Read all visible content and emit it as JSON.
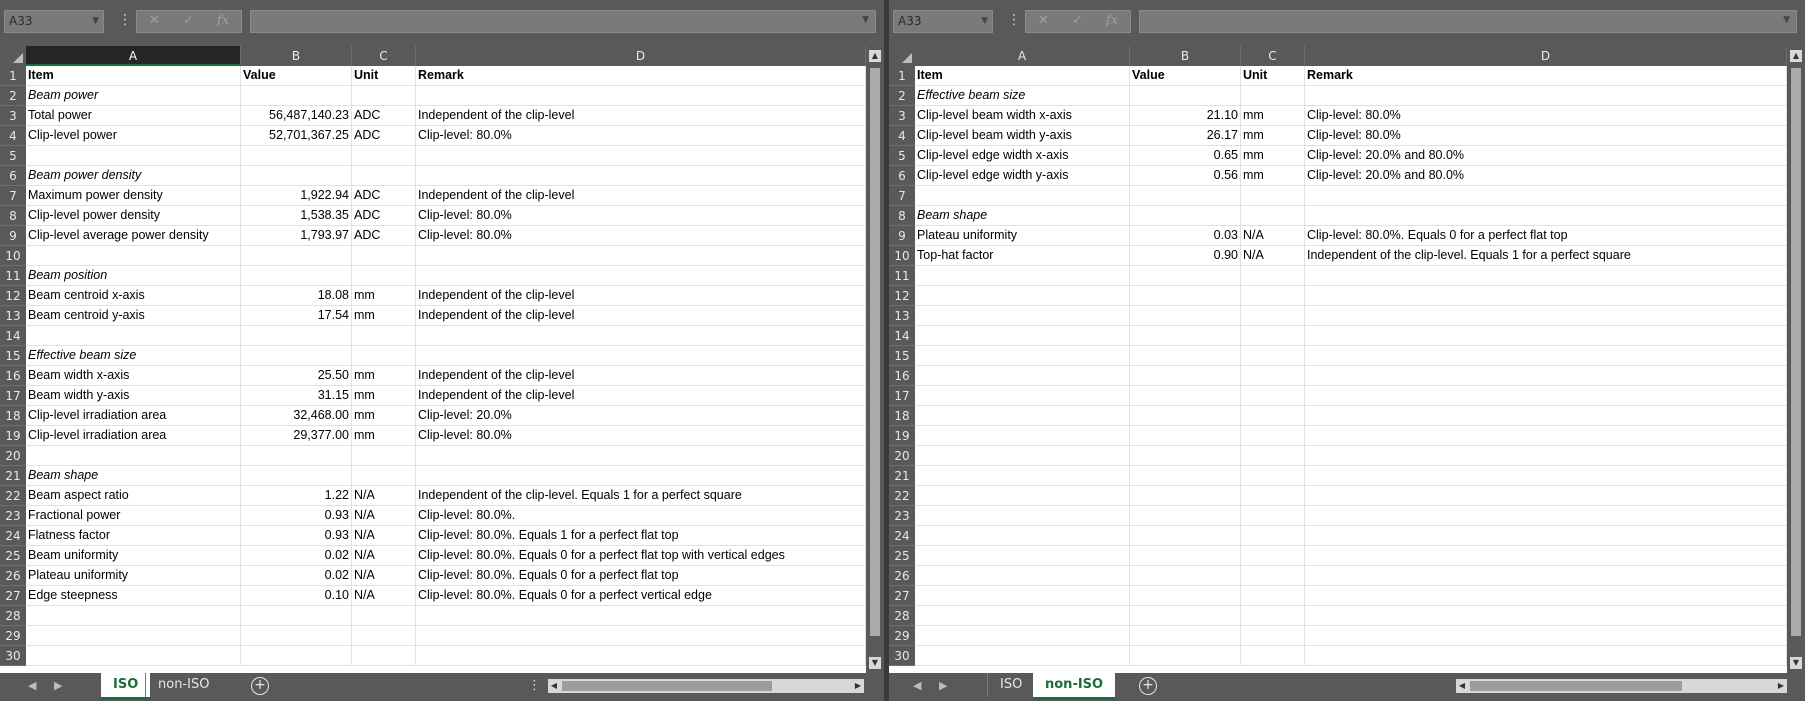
{
  "left": {
    "namebox": "A33",
    "columns": [
      "A",
      "B",
      "C",
      "D"
    ],
    "rows": [
      {
        "n": "1",
        "a": "Item",
        "b": "Value",
        "c": "Unit",
        "d": "Remark",
        "style": "bold"
      },
      {
        "n": "2",
        "a": "Beam power",
        "b": "",
        "c": "",
        "d": "",
        "style": "ital"
      },
      {
        "n": "3",
        "a": "Total power",
        "b": "56,487,140.23",
        "c": "ADC",
        "d": "Independent of the clip-level"
      },
      {
        "n": "4",
        "a": "Clip-level power",
        "b": "52,701,367.25",
        "c": "ADC",
        "d": "Clip-level: 80.0%"
      },
      {
        "n": "5",
        "a": "",
        "b": "",
        "c": "",
        "d": ""
      },
      {
        "n": "6",
        "a": "Beam power density",
        "b": "",
        "c": "",
        "d": "",
        "style": "ital"
      },
      {
        "n": "7",
        "a": "Maximum power density",
        "b": "1,922.94",
        "c": "ADC",
        "d": "Independent of the clip-level"
      },
      {
        "n": "8",
        "a": "Clip-level power density",
        "b": "1,538.35",
        "c": "ADC",
        "d": "Clip-level: 80.0%"
      },
      {
        "n": "9",
        "a": "Clip-level average power density",
        "b": "1,793.97",
        "c": "ADC",
        "d": "Clip-level: 80.0%"
      },
      {
        "n": "10",
        "a": "",
        "b": "",
        "c": "",
        "d": ""
      },
      {
        "n": "11",
        "a": "Beam position",
        "b": "",
        "c": "",
        "d": "",
        "style": "ital"
      },
      {
        "n": "12",
        "a": "Beam centroid x-axis",
        "b": "18.08",
        "c": "mm",
        "d": "Independent of the clip-level"
      },
      {
        "n": "13",
        "a": "Beam centroid y-axis",
        "b": "17.54",
        "c": "mm",
        "d": "Independent of the clip-level"
      },
      {
        "n": "14",
        "a": "",
        "b": "",
        "c": "",
        "d": ""
      },
      {
        "n": "15",
        "a": "Effective beam size",
        "b": "",
        "c": "",
        "d": "",
        "style": "ital"
      },
      {
        "n": "16",
        "a": "Beam width x-axis",
        "b": "25.50",
        "c": "mm",
        "d": "Independent of the clip-level"
      },
      {
        "n": "17",
        "a": "Beam width y-axis",
        "b": "31.15",
        "c": "mm",
        "d": "Independent of the clip-level"
      },
      {
        "n": "18",
        "a": "Clip-level irradiation area",
        "b": "32,468.00",
        "c": "mm",
        "d": "Clip-level: 20.0%"
      },
      {
        "n": "19",
        "a": "Clip-level irradiation area",
        "b": "29,377.00",
        "c": "mm",
        "d": "Clip-level: 80.0%"
      },
      {
        "n": "20",
        "a": "",
        "b": "",
        "c": "",
        "d": ""
      },
      {
        "n": "21",
        "a": "Beam shape",
        "b": "",
        "c": "",
        "d": "",
        "style": "ital"
      },
      {
        "n": "22",
        "a": "Beam aspect ratio",
        "b": "1.22",
        "c": "N/A",
        "d": "Independent of the clip-level. Equals 1 for a perfect square"
      },
      {
        "n": "23",
        "a": "Fractional power",
        "b": "0.93",
        "c": "N/A",
        "d": "Clip-level: 80.0%."
      },
      {
        "n": "24",
        "a": "Flatness factor",
        "b": "0.93",
        "c": "N/A",
        "d": "Clip-level: 80.0%. Equals 1 for a perfect flat top"
      },
      {
        "n": "25",
        "a": "Beam uniformity",
        "b": "0.02",
        "c": "N/A",
        "d": "Clip-level: 80.0%. Equals 0 for a perfect flat top with vertical edges"
      },
      {
        "n": "26",
        "a": "Plateau uniformity",
        "b": "0.02",
        "c": "N/A",
        "d": "Clip-level: 80.0%. Equals 0 for a perfect flat top"
      },
      {
        "n": "27",
        "a": "Edge steepness",
        "b": "0.10",
        "c": "N/A",
        "d": "Clip-level: 80.0%. Equals 0 for a perfect vertical edge"
      },
      {
        "n": "28",
        "a": "",
        "b": "",
        "c": "",
        "d": ""
      },
      {
        "n": "29",
        "a": "",
        "b": "",
        "c": "",
        "d": ""
      },
      {
        "n": "30",
        "a": "",
        "b": "",
        "c": "",
        "d": ""
      }
    ],
    "tabs": [
      "ISO",
      "non-ISO"
    ],
    "active_tab": "ISO"
  },
  "right": {
    "namebox": "A33",
    "columns": [
      "A",
      "B",
      "C",
      "D"
    ],
    "rows": [
      {
        "n": "1",
        "a": "Item",
        "b": "Value",
        "c": "Unit",
        "d": "Remark",
        "style": "bold"
      },
      {
        "n": "2",
        "a": "Effective beam size",
        "b": "",
        "c": "",
        "d": "",
        "style": "ital"
      },
      {
        "n": "3",
        "a": "Clip-level beam width x-axis",
        "b": "21.10",
        "c": "mm",
        "d": "Clip-level: 80.0%"
      },
      {
        "n": "4",
        "a": "Clip-level beam width y-axis",
        "b": "26.17",
        "c": "mm",
        "d": "Clip-level: 80.0%"
      },
      {
        "n": "5",
        "a": "Clip-level edge width x-axis",
        "b": "0.65",
        "c": "mm",
        "d": "Clip-level: 20.0% and 80.0%"
      },
      {
        "n": "6",
        "a": "Clip-level edge width y-axis",
        "b": "0.56",
        "c": "mm",
        "d": "Clip-level: 20.0% and 80.0%"
      },
      {
        "n": "7",
        "a": "",
        "b": "",
        "c": "",
        "d": ""
      },
      {
        "n": "8",
        "a": "Beam shape",
        "b": "",
        "c": "",
        "d": "",
        "style": "ital"
      },
      {
        "n": "9",
        "a": "Plateau uniformity",
        "b": "0.03",
        "c": "N/A",
        "d": "Clip-level: 80.0%. Equals 0 for a perfect flat top"
      },
      {
        "n": "10",
        "a": "Top-hat factor",
        "b": "0.90",
        "c": "N/A",
        "d": "Independent of the clip-level. Equals 1 for a perfect square"
      },
      {
        "n": "11",
        "a": "",
        "b": "",
        "c": "",
        "d": ""
      },
      {
        "n": "12",
        "a": "",
        "b": "",
        "c": "",
        "d": ""
      },
      {
        "n": "13",
        "a": "",
        "b": "",
        "c": "",
        "d": ""
      },
      {
        "n": "14",
        "a": "",
        "b": "",
        "c": "",
        "d": ""
      },
      {
        "n": "15",
        "a": "",
        "b": "",
        "c": "",
        "d": ""
      },
      {
        "n": "16",
        "a": "",
        "b": "",
        "c": "",
        "d": ""
      },
      {
        "n": "17",
        "a": "",
        "b": "",
        "c": "",
        "d": ""
      },
      {
        "n": "18",
        "a": "",
        "b": "",
        "c": "",
        "d": ""
      },
      {
        "n": "19",
        "a": "",
        "b": "",
        "c": "",
        "d": ""
      },
      {
        "n": "20",
        "a": "",
        "b": "",
        "c": "",
        "d": ""
      },
      {
        "n": "21",
        "a": "",
        "b": "",
        "c": "",
        "d": ""
      },
      {
        "n": "22",
        "a": "",
        "b": "",
        "c": "",
        "d": ""
      },
      {
        "n": "23",
        "a": "",
        "b": "",
        "c": "",
        "d": ""
      },
      {
        "n": "24",
        "a": "",
        "b": "",
        "c": "",
        "d": ""
      },
      {
        "n": "25",
        "a": "",
        "b": "",
        "c": "",
        "d": ""
      },
      {
        "n": "26",
        "a": "",
        "b": "",
        "c": "",
        "d": ""
      },
      {
        "n": "27",
        "a": "",
        "b": "",
        "c": "",
        "d": ""
      },
      {
        "n": "28",
        "a": "",
        "b": "",
        "c": "",
        "d": ""
      },
      {
        "n": "29",
        "a": "",
        "b": "",
        "c": "",
        "d": ""
      },
      {
        "n": "30",
        "a": "",
        "b": "",
        "c": "",
        "d": ""
      }
    ],
    "tabs": [
      "ISO",
      "non-ISO"
    ],
    "active_tab": "non-ISO"
  },
  "formula_bar": {
    "fx_label": "fx",
    "cancel_label": "✕",
    "enter_label": "✓"
  },
  "colors": {
    "accent": "#1d6b3a",
    "chrome": "#595959",
    "grid_line": "#e1e1e1"
  }
}
